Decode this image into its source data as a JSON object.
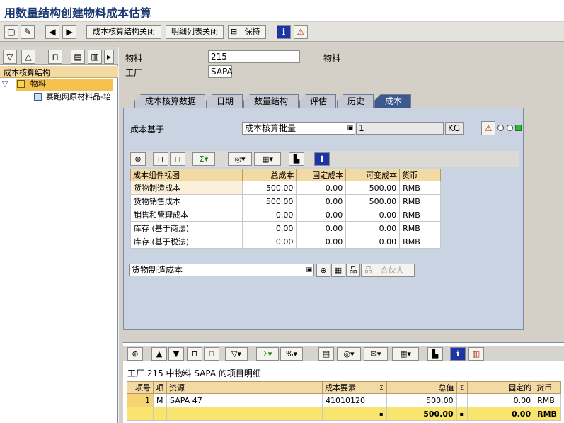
{
  "window": {
    "title": "用数量结构创建物料成本估算"
  },
  "toolbar": {
    "btn_close_structure": "成本核算结构关闭",
    "btn_close_detail": "明细列表关闭",
    "btn_save": "保持"
  },
  "tree": {
    "header": "成本核算结构",
    "root_label": "物料",
    "child_label": "赛跑网原材料品-培"
  },
  "header_fields": {
    "material_label": "物料",
    "material_value": "215",
    "material_desc": "物料",
    "plant_label": "工厂",
    "plant_value": "SAPA"
  },
  "tabs": [
    "成本核算数据",
    "日期",
    "数量结构",
    "评估",
    "历史",
    "成本"
  ],
  "cost_panel": {
    "basis_label": "成本基于",
    "basis_value": "成本核算批量",
    "lot_size": "1",
    "unit": "KG",
    "bottom_select": "货物制造成本",
    "partner_btn": "合伙人"
  },
  "cost_table": {
    "columns": [
      "成本组件视图",
      "总成本",
      "固定成本",
      "可变成本",
      "货币"
    ],
    "rows": [
      [
        "货物制造成本",
        "500.00",
        "0.00",
        "500.00",
        "RMB"
      ],
      [
        "货物销售成本",
        "500.00",
        "0.00",
        "500.00",
        "RMB"
      ],
      [
        "销售和管理成本",
        "0.00",
        "0.00",
        "0.00",
        "RMB"
      ],
      [
        "库存 (基于商法)",
        "0.00",
        "0.00",
        "0.00",
        "RMB"
      ],
      [
        "库存 (基于税法)",
        "0.00",
        "0.00",
        "0.00",
        "RMB"
      ]
    ]
  },
  "item_detail": {
    "title": "工厂 215 中物料 SAPA 的项目明细",
    "columns": [
      "项号",
      "项",
      "资源",
      "成本要素",
      "Σ",
      "总值",
      "Σ",
      "固定的",
      "货币"
    ],
    "row": [
      "1",
      "M",
      "SAPA 47",
      "41010120",
      "",
      "500.00",
      "",
      "0.00",
      "RMB"
    ],
    "total_marker": "▪",
    "total_value": "500.00",
    "total_fixed": "0.00",
    "total_currency": "RMB"
  }
}
